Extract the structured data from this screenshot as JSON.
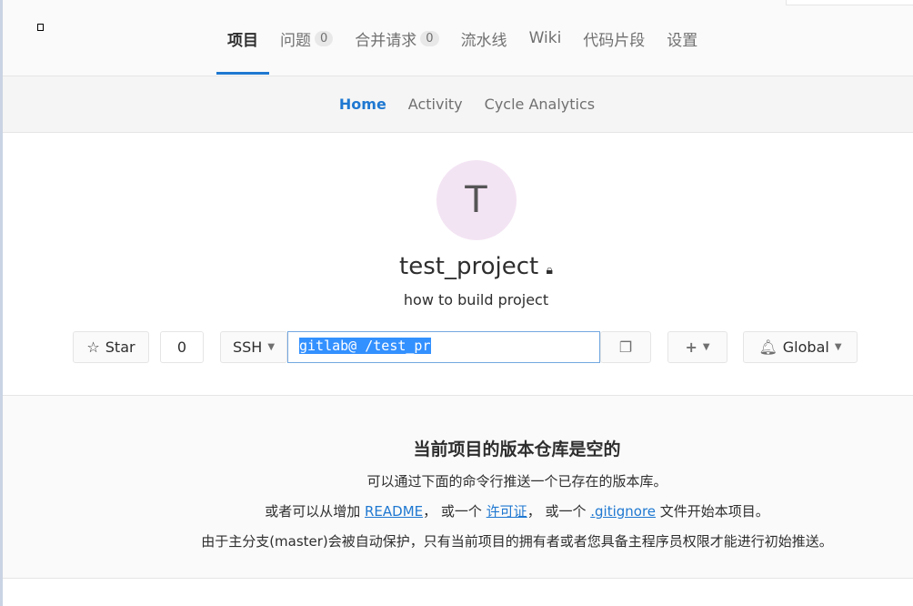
{
  "nav": {
    "items": [
      {
        "label": "项目"
      },
      {
        "label": "问题",
        "count": "0"
      },
      {
        "label": "合并请求",
        "count": "0"
      },
      {
        "label": "流水线"
      },
      {
        "label": "Wiki"
      },
      {
        "label": "代码片段"
      },
      {
        "label": "设置"
      }
    ]
  },
  "subnav": {
    "items": [
      "Home",
      "Activity",
      "Cycle Analytics"
    ]
  },
  "project": {
    "avatar_letter": "T",
    "name": "test_project",
    "description": "how to build project"
  },
  "controls": {
    "star_label": "Star",
    "star_count": "0",
    "protocol": "SSH",
    "clone_url": "gitlab@                         /test_pr",
    "notify_label": "Global"
  },
  "empty": {
    "title": "当前项目的版本仓库是空的",
    "line1": "可以通过下面的命令行推送一个已存在的版本库。",
    "line2_a": "或者可以从增加 ",
    "readme": "README",
    "line2_b": "， 或一个 ",
    "license": "许可证",
    "line2_c": "， 或一个 ",
    "gitignore": ".gitignore",
    "line2_d": " 文件开始本项目。",
    "line3": "由于主分支(master)会被自动保护，只有当前项目的拥有者或者您具备主程序员权限才能进行初始推送。"
  },
  "colors": {
    "accent": "#1f78d1",
    "avatar_bg": "#f3e4f3"
  }
}
